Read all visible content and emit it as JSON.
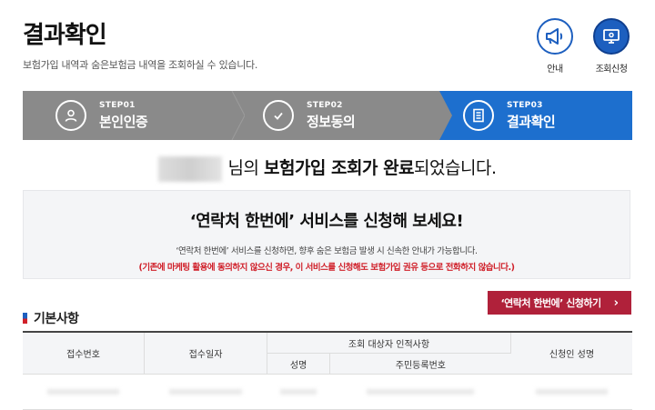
{
  "header": {
    "title": "결과확인",
    "subtitle": "보험가입 내역과 숨은보험금 내역을 조회하실 수 있습니다.",
    "guide_label": "안내",
    "check_label": "조회신청"
  },
  "steps": [
    {
      "num": "STEP01",
      "name": "본인인증",
      "icon": "user-icon"
    },
    {
      "num": "STEP02",
      "name": "정보동의",
      "icon": "check-circle-icon"
    },
    {
      "num": "STEP03",
      "name": "결과확인",
      "icon": "document-icon",
      "active": true
    }
  ],
  "result": {
    "suffix_pre": "님의 ",
    "highlight": "보험가입 조회가 완료",
    "suffix_post": "되었습니다."
  },
  "promo": {
    "heading": "‘연락처 한번에’ 서비스를 신청해 보세요!",
    "desc": "‘연락처 한번에’ 서비스를 신청하면, 향후 숨은 보험금 발생 시 신속한 안내가 가능합니다.",
    "notice": "(기존에 마케팅 활용에 동의하지 않으신 경우, 이 서비스를 신청해도 보험가입 권유 등으로 전화하지 않습니다.)"
  },
  "apply_button": "‘연락처 한번에’ 신청하기",
  "section_title": "기본사항",
  "table": {
    "headers": [
      "접수번호",
      "접수일자",
      "조회 대상자 인적사항",
      "신청인 성명"
    ],
    "subheaders": [
      "성명",
      "주민등록번호"
    ]
  },
  "colors": {
    "primary": "#1d6fce",
    "inactive": "#8a8a8a",
    "accent": "#b0213a",
    "alert": "#d0202a"
  }
}
